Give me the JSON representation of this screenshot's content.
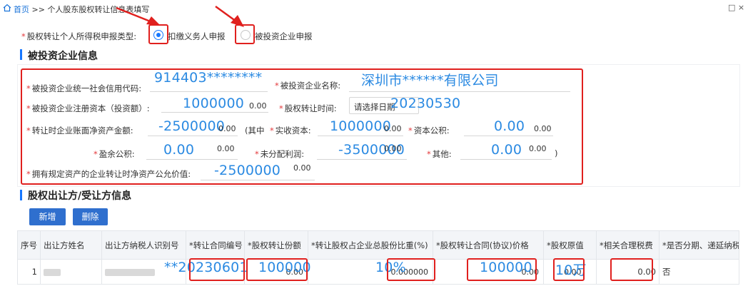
{
  "header": {
    "home": "首页",
    "sep": ">>",
    "page_title": "个人股东股权转让信息表填写",
    "window_controls": "□ ×"
  },
  "declare": {
    "label": "股权转让个人所得税申报类型:",
    "option1": "扣缴义务人申报",
    "option2": "被投资企业申报"
  },
  "section1": {
    "title": "被投资企业信息"
  },
  "company": {
    "credit_code_label": "被投资企业统一社会信用代码:",
    "credit_code_value": "914403********",
    "name_label": "被投资企业名称:",
    "name_value": "深圳市******有限公司",
    "capital_label": "被投资企业注册资本（投资额）:",
    "capital_value": "1000000",
    "capital_default": "0.00",
    "transfer_time_label": "股权转让时间:",
    "transfer_time_placeholder": "请选择日期",
    "transfer_time_value": "20230530",
    "net_assets_label": "转让时企业账面净资产金额:",
    "net_assets_value": "-2500000",
    "net_assets_default": "0.00",
    "paid_in_prefix": "(其中",
    "paid_in_label": "实收资本:",
    "paid_in_value": "1000000",
    "paid_in_default": "0.00",
    "capital_reserve_label": "资本公积:",
    "capital_reserve_value": "0.00",
    "capital_reserve_default": "0.00",
    "surplus_label": "盈余公积:",
    "surplus_value": "0.00",
    "surplus_default": "0.00",
    "undistributed_label": "未分配利润:",
    "undistributed_value": "-3500000",
    "undistributed_default": "0.00",
    "other_label": "其他:",
    "other_value": "0.00",
    "other_default": "0.00",
    "paren_close": ")",
    "fair_value_label": "拥有规定资产的企业转让时净资产公允价值:",
    "fair_value_value": "-2500000",
    "fair_value_default": "0.00"
  },
  "section2": {
    "title": "股权出让方/受让方信息"
  },
  "buttons": {
    "add": "新增",
    "delete": "删除"
  },
  "table": {
    "headers": [
      "序号",
      "出让方姓名",
      "出让方纳税人识别号",
      "*转让合同编号",
      "*股权转让份额",
      "*转让股权占企业总股份比重(%)",
      "*股权转让合同(协议)价格",
      "*股权原值",
      "*相关合理税费",
      "*是否分期、递延纳税"
    ],
    "row": {
      "index": "1",
      "contract_no": "**20230601",
      "share": "100000",
      "share_default": "0.00",
      "ratio": "10%",
      "ratio_default": "0.000000",
      "price": "100000",
      "price_default": "0.00",
      "original_value": "10万",
      "original_default": "0.00",
      "tax_fee": "0.00",
      "installment": "否"
    }
  }
}
